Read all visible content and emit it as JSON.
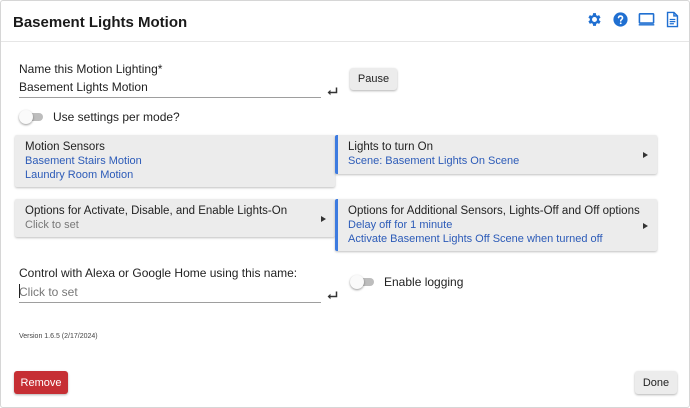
{
  "app": {
    "title": "Basement Lights Motion"
  },
  "header_icons": [
    "gear-icon",
    "help-icon",
    "monitor-icon",
    "document-icon"
  ],
  "colors": {
    "accent": "#3d7be0",
    "link": "#2c5bb8",
    "remove": "#c62f34"
  },
  "name_field": {
    "label": "Name this Motion Lighting*",
    "value": "Basement Lights Motion"
  },
  "pause_button": {
    "label": "Pause"
  },
  "use_settings_per_mode": {
    "label": "Use settings per mode?",
    "checked": false
  },
  "motion_sensors": {
    "title": "Motion Sensors",
    "items": [
      "Basement Stairs Motion",
      "Laundry Room Motion"
    ]
  },
  "lights_on": {
    "title": "Lights to turn On",
    "items": [
      "Scene: Basement Lights On Scene"
    ]
  },
  "options_activate": {
    "title": "Options for Activate, Disable, and Enable Lights-On",
    "subtitle": "Click to set"
  },
  "options_additional": {
    "title": "Options for Additional Sensors, Lights-Off and Off options",
    "items": [
      "Delay off for 1 minute",
      "Activate Basement Lights Off Scene when turned off"
    ]
  },
  "alexa_field": {
    "label": "Control with Alexa or Google Home using this name:",
    "placeholder": "Click to set"
  },
  "enable_logging": {
    "label": "Enable logging",
    "checked": false
  },
  "version": "Version 1.6.5 (2/17/2024)",
  "remove_button": {
    "label": "Remove"
  },
  "done_button": {
    "label": "Done"
  }
}
